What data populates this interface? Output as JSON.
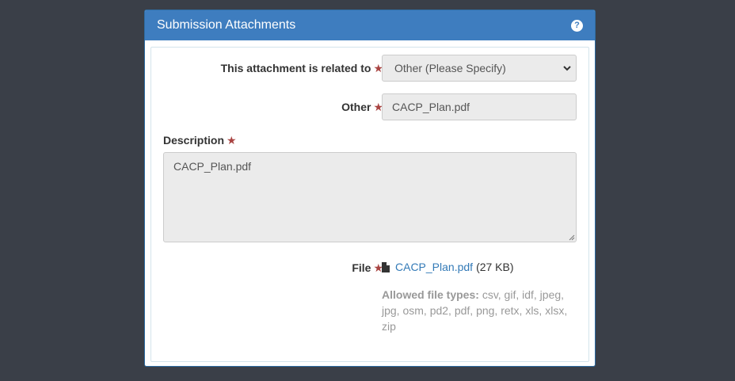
{
  "modal": {
    "title": "Submission Attachments",
    "help_icon": "question-circle-icon"
  },
  "form": {
    "related_label": "This attachment is related to",
    "related_value": "Other (Please Specify)",
    "other_label": "Other",
    "other_value": "CACP_Plan.pdf",
    "description_label": "Description",
    "description_value": "CACP_Plan.pdf",
    "file_label": "File",
    "required_mark": "★",
    "file_name": "CACP_Plan.pdf",
    "file_size": "(27 KB)",
    "allowed_label": "Allowed file types:",
    "allowed_types": "csv, gif, idf, jpeg, jpg, osm, pd2, pdf, png, retx, xls, xlsx, zip"
  },
  "colors": {
    "header_bg": "#3e7dbf",
    "page_bg": "#3a3f48",
    "required": "#a94442",
    "link": "#337ab7"
  }
}
